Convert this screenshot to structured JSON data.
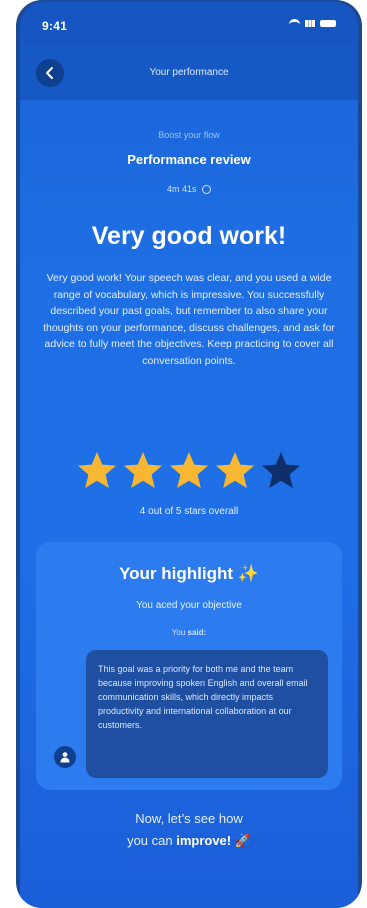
{
  "status_bar": {
    "time": "9:41"
  },
  "header": {
    "title": "Your performance"
  },
  "review": {
    "eyebrow": "Boost your flow",
    "title": "Performance review",
    "duration": "4m 41s",
    "headline": "Very good work!",
    "feedback": "Very good work! Your speech was clear, and you used a wide range of vocabulary, which is impressive. You successfully described your past goals, but remember to also share your thoughts on your performance, discuss challenges, and ask for advice to fully meet the objectives. Keep practicing to cover all conversation points."
  },
  "rating": {
    "value": 4,
    "max": 5,
    "caption": "4 out of 5 stars overall",
    "filled_color": "#f7b733",
    "empty_color": "#0f2f6b"
  },
  "highlight": {
    "title": "Your highlight ✨",
    "subtitle": "You aced your objective",
    "you_said_prefix": "You ",
    "you_said_emphasis": "said:",
    "quote": "This goal was a priority for both me and the team because improving spoken English and overall email communication skills, which directly impacts productivity and international collaboration at our customers."
  },
  "cta": {
    "line1": "Now, let’s see how",
    "line2_prefix": "you can ",
    "line2_emphasis": "improve!",
    "line2_suffix": " 🚀"
  }
}
